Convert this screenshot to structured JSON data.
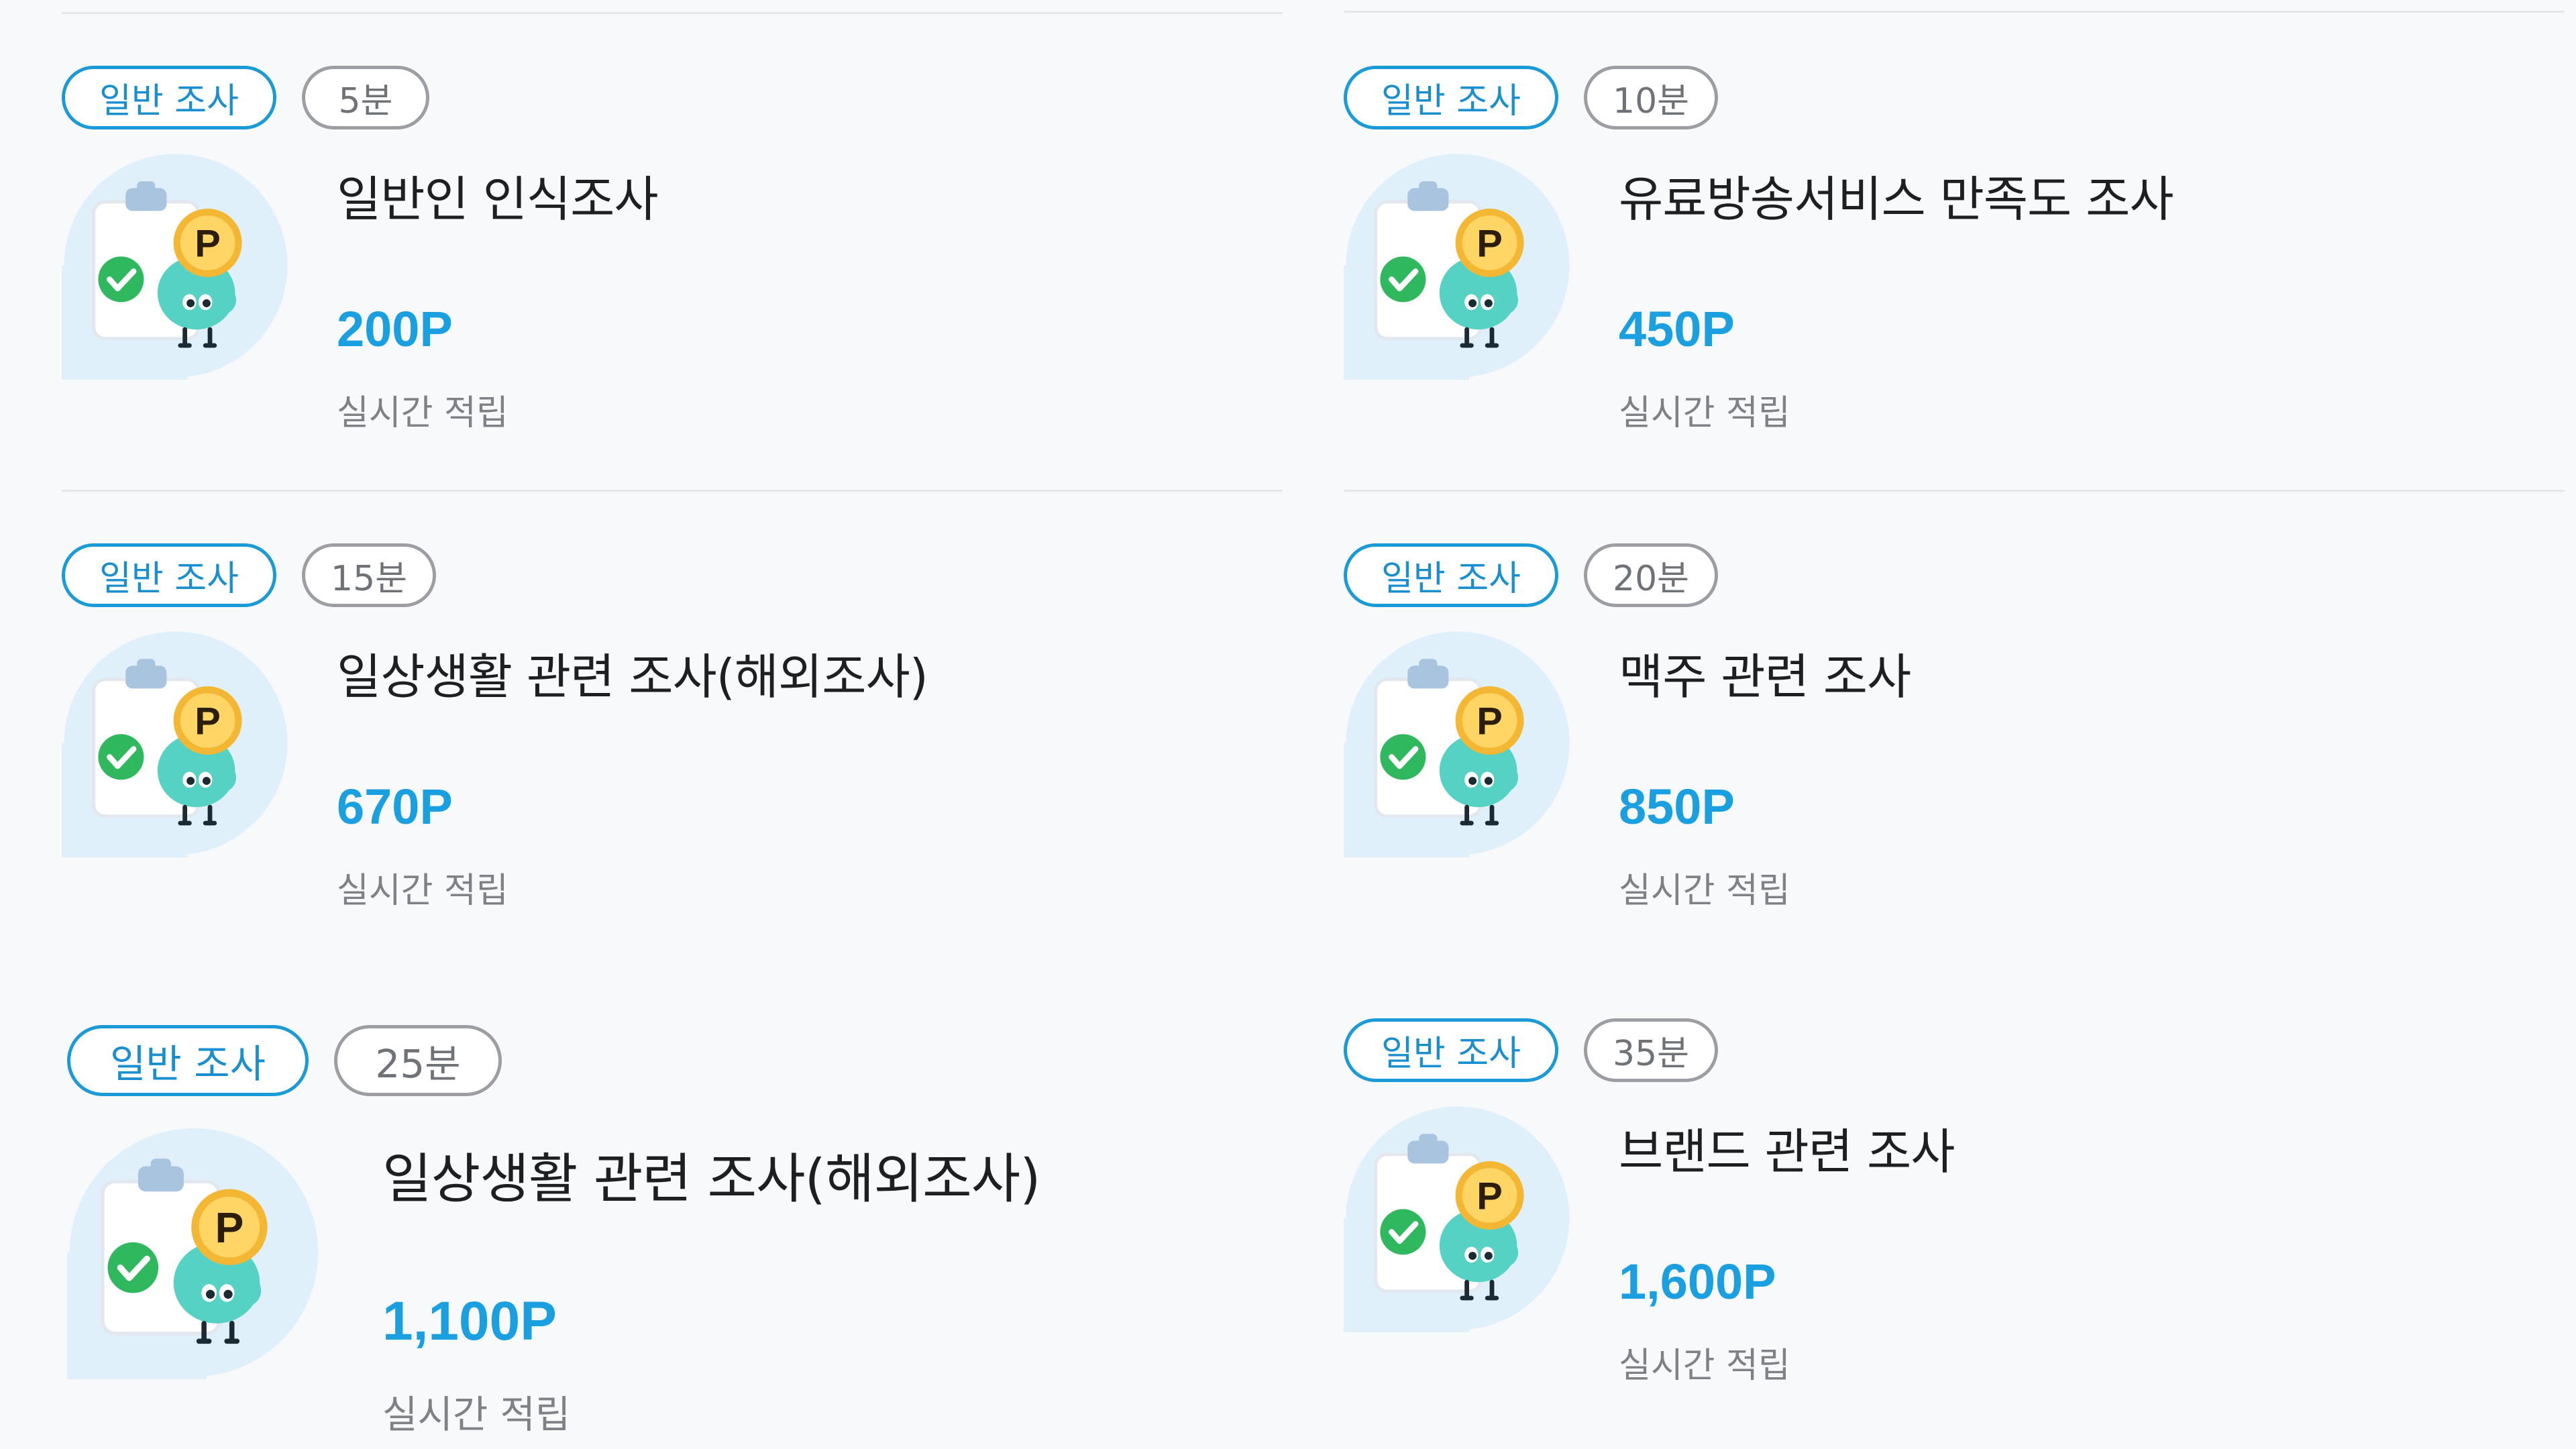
{
  "surveys": [
    {
      "type": "일반 조사",
      "duration": "5분",
      "title": "일반인 인식조사",
      "points": "200P",
      "reward_note": "실시간 적립"
    },
    {
      "type": "일반 조사",
      "duration": "10분",
      "title": "유료방송서비스 만족도 조사",
      "points": "450P",
      "reward_note": "실시간 적립"
    },
    {
      "type": "일반 조사",
      "duration": "15분",
      "title": "일상생활 관련 조사(해외조사)",
      "points": "670P",
      "reward_note": "실시간 적립"
    },
    {
      "type": "일반 조사",
      "duration": "20분",
      "title": "맥주 관련 조사",
      "points": "850P",
      "reward_note": "실시간 적립"
    },
    {
      "type": "일반 조사",
      "duration": "25분",
      "title": "일상생활 관련 조사(해외조사)",
      "points": "1,100P",
      "reward_note": "실시간 적립"
    },
    {
      "type": "일반 조사",
      "duration": "35분",
      "title": "브랜드 관련 조사",
      "points": "1,600P",
      "reward_note": "실시간 적립"
    }
  ],
  "colors": {
    "accent": "#1aa0e0",
    "badge_border": "#1a9ad6",
    "time_badge_border": "#9c9ea3",
    "title_text": "#1d1f22",
    "sub_text": "#7e8186"
  },
  "icons": {
    "thumbnail": "survey-clipboard-coin-mascot-icon"
  }
}
